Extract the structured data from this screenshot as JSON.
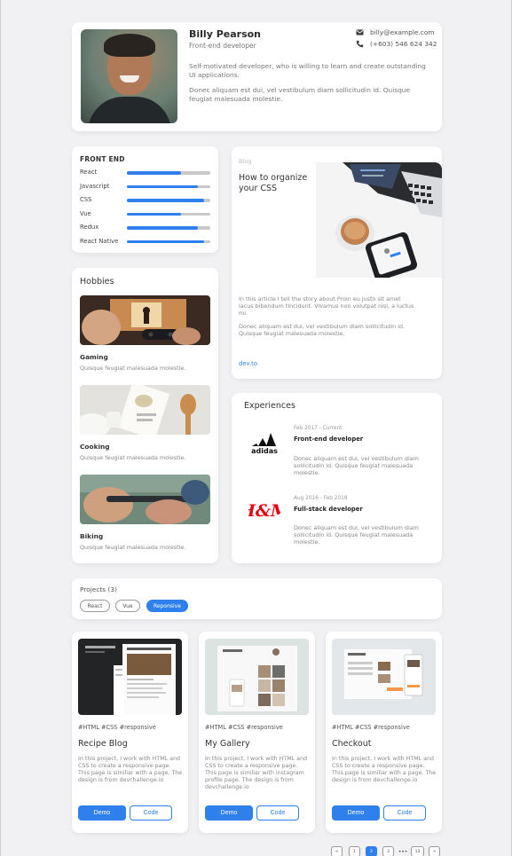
{
  "profile": {
    "name": "Billy Pearson",
    "role": "Front-end developer",
    "email": "billy@example.com",
    "phone": "(+603) 546 624 342",
    "bio1": "Self-motivated developer, who is willing to learn and create outstanding UI applications.",
    "bio2": "Donec aliquam est dui, vel vestibulum diam sollicitudin id. Quisque feugiat malesuada molestie."
  },
  "skills": {
    "title": "FRONT END",
    "items": [
      {
        "label": "React",
        "level": 0.65
      },
      {
        "label": "Javascript",
        "level": 0.85
      },
      {
        "label": "CSS",
        "level": 0.93
      },
      {
        "label": "Vue",
        "level": 0.65
      },
      {
        "label": "Redux",
        "level": 0.85
      },
      {
        "label": "React Native",
        "level": 0.93
      }
    ]
  },
  "hobbies": {
    "title": "Hobbies",
    "items": [
      {
        "name": "Gaming",
        "desc": "Quisque feugiat malesuada molestie."
      },
      {
        "name": "Cooking",
        "desc": "Quisque feugiat malesuada molestie."
      },
      {
        "name": "Biking",
        "desc": "Quisque feugiat malesuada molestie."
      }
    ]
  },
  "blog": {
    "tag": "Blog",
    "title": "How to organize your CSS",
    "p1": "In this article I tell the story about Proin eu justo sit amet lacus bibendum tincidunt. Vivamus non volutpat nisl, a luctus mi.",
    "p2": "Donec aliquam est dui, vel vestibulum diam sollicitudin id. Quisque feugiat malesuada molestie.",
    "link": "dev.to"
  },
  "experiences": {
    "title": "Experiences",
    "items": [
      {
        "company": "adidas",
        "date": "Feb 2017 - Current",
        "role": "Front-end developer",
        "desc": "Donec aliquam est dui, vel vestibulum diam sollicitudin id. Quisque feugiat malesuada molestie."
      },
      {
        "company": "H&M",
        "date": "Aug 2016 - Feb 2018",
        "role": "Full-stack developer",
        "desc": "Donec aliquam est dui, vel vestibulum diam sollicitudin id. Quisque feugiat malesuada molestie."
      }
    ]
  },
  "projects": {
    "title": "Projects (3)",
    "filters": [
      {
        "label": "React",
        "active": false
      },
      {
        "label": "Vue",
        "active": false
      },
      {
        "label": "Reponsive",
        "active": true
      }
    ],
    "items": [
      {
        "tags": "#HTML   #CSS   #responsive",
        "title": "Recipe Blog",
        "desc": "In this project, I work with HTML and CSS to create a responsive page. This page is similiar with a page. The design is from devchallenge.io",
        "demo": "Demo",
        "code": "Code"
      },
      {
        "tags": "#HTML   #CSS   #responsive",
        "title": "My Gallery",
        "desc": "In this project, I work with HTML and CSS to create a responsive page. This page is similiar with instagram profile page. The design is from devchallenge.io",
        "demo": "Demo",
        "code": "Code"
      },
      {
        "tags": "#HTML   #CSS   #responsive",
        "title": "Checkout",
        "desc": "In this project, I work with HTML and CSS to create a responsive page. This page is similiar with a page. The design is from devchallenge.io",
        "demo": "Demo",
        "code": "Code"
      }
    ]
  },
  "pagination": {
    "prev": "<",
    "pages": [
      "1",
      "2",
      "3"
    ],
    "current": "2",
    "ellipsis": "•••",
    "last": "13",
    "next": ">"
  },
  "colors": {
    "accent": "#2f80ed",
    "background": "#f1f1f3",
    "hm_red": "#e50010"
  }
}
